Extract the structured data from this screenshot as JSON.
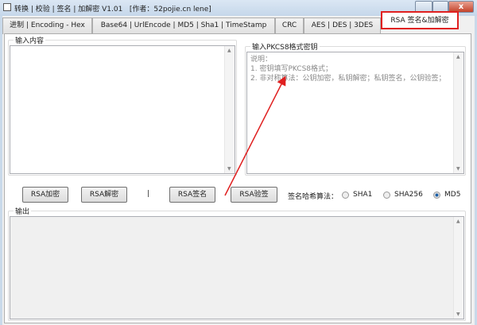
{
  "window": {
    "title": "转换 | 校验 | 签名 | 加解密 V1.01",
    "author": "[作者：52pojie.cn lene]"
  },
  "tabs": [
    {
      "label": "进制 | Encoding - Hex"
    },
    {
      "label": "Base64 | UrlEncode | MD5 | Sha1 | TimeStamp"
    },
    {
      "label": "CRC"
    },
    {
      "label": "AES | DES | 3DES"
    },
    {
      "label": "RSA 签名&加解密",
      "active": true
    }
  ],
  "input": {
    "label": "输入内容",
    "value": ""
  },
  "key": {
    "label": "输入PKCS8格式密钥",
    "placeholder_lines": [
      "说明：",
      "1. 密钥填写PKCS8格式；",
      "2. 非对称算法：公钥加密，私钥解密；私钥签名，公钥验签；"
    ]
  },
  "buttons": {
    "encrypt": "RSA加密",
    "decrypt": "RSA解密",
    "separator": "|",
    "sign": "RSA签名",
    "verify": "RSA验签"
  },
  "hash": {
    "label": "签名哈希算法：",
    "options": [
      "SHA1",
      "SHA256",
      "MD5"
    ],
    "selected": "MD5"
  },
  "output": {
    "label": "输出",
    "value": ""
  },
  "colors": {
    "highlight": "#e02020"
  }
}
